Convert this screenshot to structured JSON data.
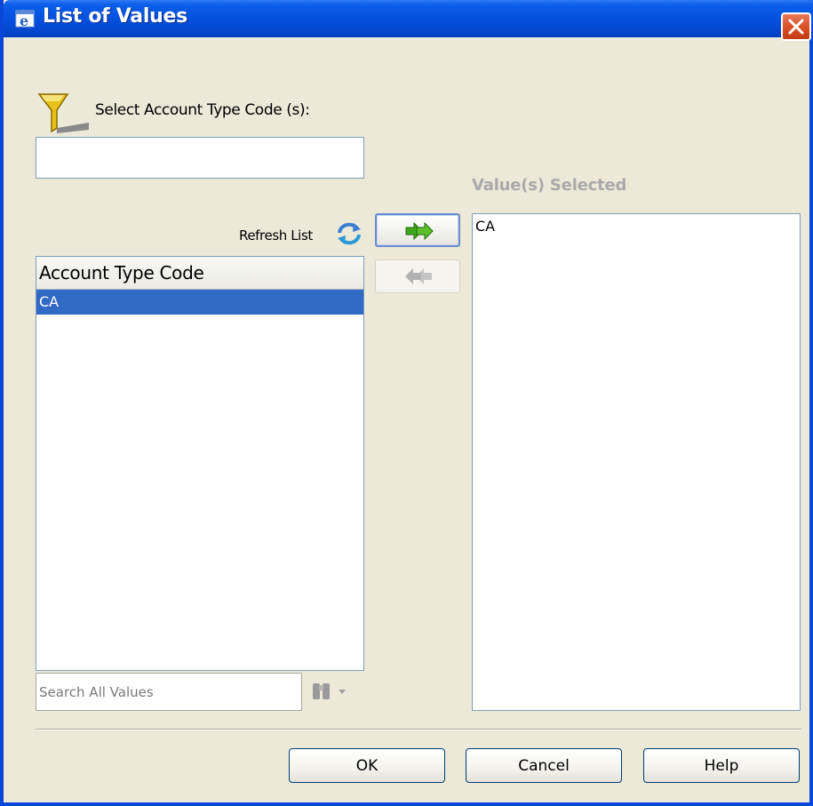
{
  "window": {
    "title": "List of Values",
    "title_icon": "ie-window-icon",
    "close_icon": "close-icon"
  },
  "filter": {
    "icon": "filter-funnel-icon",
    "label": "Select Account Type Code (s):",
    "value": ""
  },
  "available": {
    "refresh_label": "Refresh List",
    "refresh_icon": "refresh-icon",
    "column_header": "Account Type Code",
    "rows": [
      "CA"
    ],
    "selected_row_index": 0
  },
  "search": {
    "placeholder": "Search All Values",
    "value": "",
    "icon": "binoculars-icon"
  },
  "transfer": {
    "add_icon": "double-arrow-right-icon",
    "remove_icon": "double-arrow-left-icon"
  },
  "selected": {
    "label": "Value(s) Selected",
    "items": [
      "CA"
    ]
  },
  "buttons": {
    "ok": "OK",
    "cancel": "Cancel",
    "help": "Help"
  },
  "colors": {
    "titlebar": "#0553e0",
    "dialog_bg": "#ece9d8",
    "selection": "#316ac5",
    "close_button": "#d9502a",
    "arrow_green": "#3fa61c"
  }
}
